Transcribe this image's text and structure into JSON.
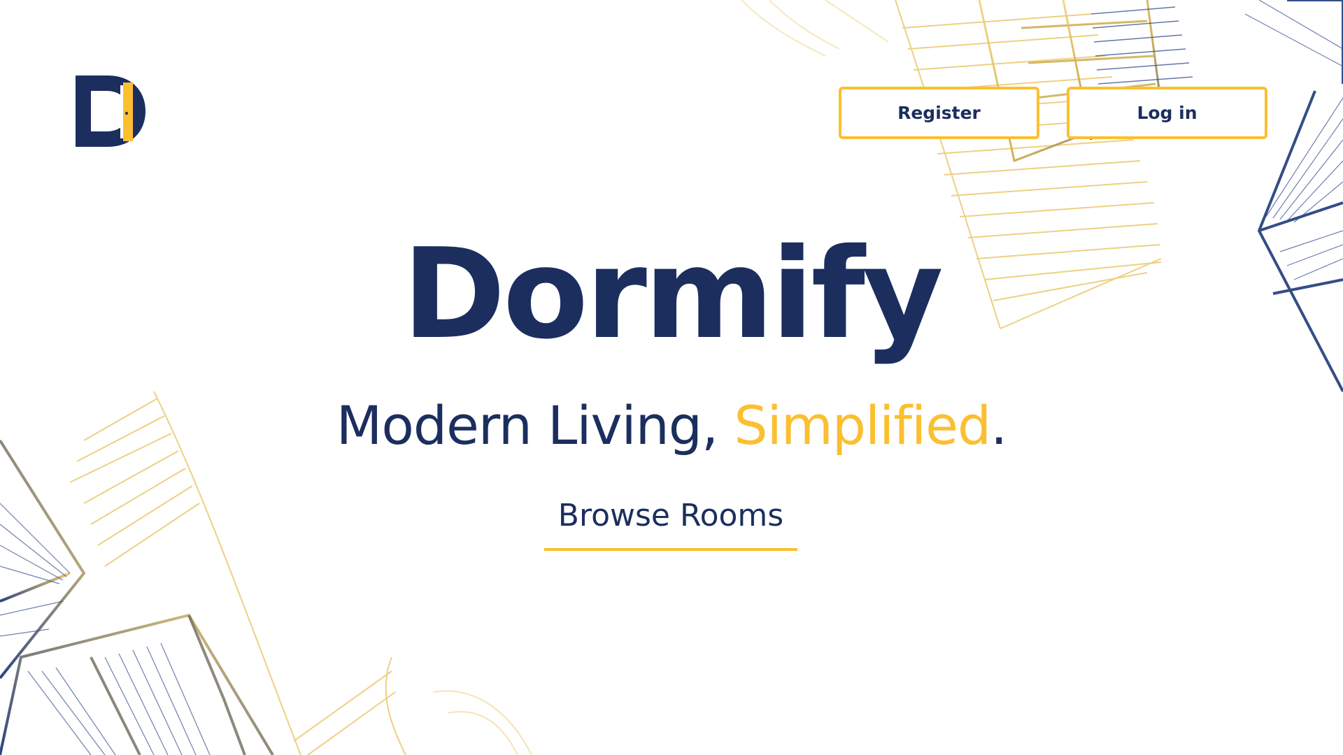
{
  "brand": {
    "logo_icon": "dormify-logo-icon",
    "title": "Dormify"
  },
  "nav": {
    "register_label": "Register",
    "login_label": "Log in"
  },
  "hero": {
    "tagline_part1": "Modern Living, ",
    "tagline_accent": "Simplified",
    "tagline_end": ".",
    "browse_label": "Browse Rooms"
  },
  "colors": {
    "navy": "#1B2E5E",
    "gold": "#FBBF2F",
    "background": "#FFFFFF"
  }
}
